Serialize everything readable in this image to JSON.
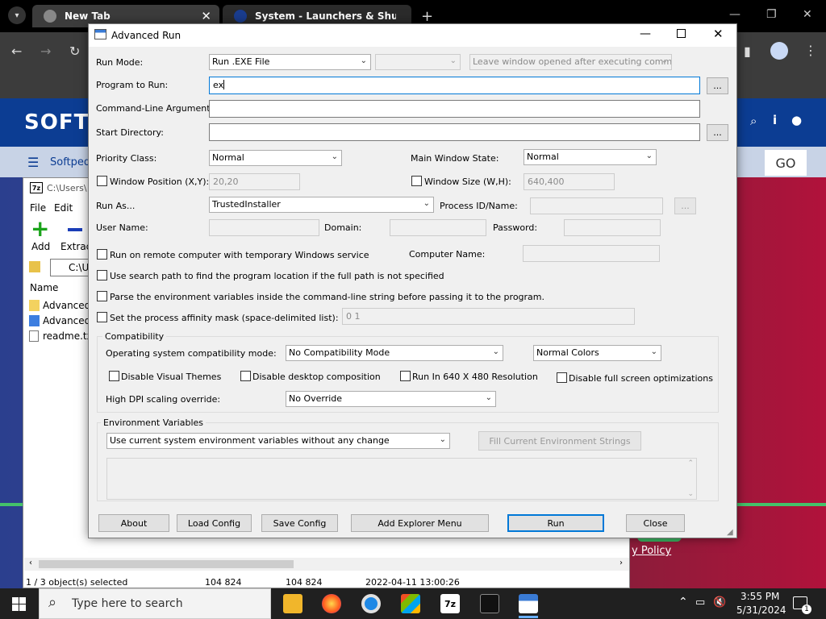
{
  "browser": {
    "tabs": [
      {
        "title": "New Tab"
      },
      {
        "title": "System - Launchers & Shutdow"
      }
    ]
  },
  "softpedia": {
    "logo": "SOFTI",
    "nav_label": "Softpedi",
    "go": "GO",
    "privacy_link": "y Policy"
  },
  "zip": {
    "path": "C:\\Users\\",
    "menu": [
      "File",
      "Edit"
    ],
    "tool_add": "Add",
    "tool_extract": "Extrac",
    "address": "C:\\U",
    "column_name": "Name",
    "files": [
      "Advanced",
      "Advanced",
      "readme.txt"
    ],
    "status": [
      "1 / 3 object(s) selected",
      "104 824",
      "104 824",
      "2022-04-11 13:00:26"
    ]
  },
  "dialog": {
    "title": "Advanced Run",
    "labels": {
      "run_mode": "Run Mode:",
      "program_to_run": "Program to Run:",
      "cmd_args": "Command-Line Arguments:",
      "start_dir": "Start Directory:",
      "priority_class": "Priority Class:",
      "main_window_state": "Main Window State:",
      "window_position": "Window Position (X,Y):",
      "window_size": "Window Size (W,H):",
      "run_as": "Run As...",
      "process_id": "Process ID/Name:",
      "user_name": "User Name:",
      "domain": "Domain:",
      "password": "Password:",
      "remote": "Run on remote computer with temporary Windows service",
      "computer_name": "Computer Name:",
      "search_path": "Use search path to find the program location if the full path is not specified",
      "parse_env": "Parse the environment variables inside the command-line string before passing it to the program.",
      "affinity": "Set the process affinity mask (space-delimited list):",
      "compat_group": "Compatibility",
      "os_compat": "Operating system compatibility mode:",
      "disable_themes": "Disable Visual Themes",
      "disable_desktop": "Disable desktop composition",
      "run_640": "Run In 640 X 480 Resolution",
      "disable_fullscreen": "Disable full screen optimizations",
      "dpi_override": "High DPI scaling override:",
      "env_group": "Environment Variables"
    },
    "values": {
      "run_mode": "Run .EXE File",
      "leave_window": "Leave window opened after executing command",
      "program": "ex",
      "priority": "Normal",
      "window_state": "Normal",
      "position": "20,20",
      "size": "640,400",
      "run_as": "TrustedInstaller",
      "affinity": "0 1",
      "compat_mode": "No Compatibility Mode",
      "colors": "Normal Colors",
      "dpi": "No Override",
      "env_mode": "Use current system environment variables without any change"
    },
    "buttons": {
      "browse": "...",
      "fill_env": "Fill Current Environment Strings",
      "about": "About",
      "load_config": "Load Config",
      "save_config": "Save Config",
      "add_explorer": "Add Explorer Menu",
      "run": "Run",
      "close": "Close"
    }
  },
  "taskbar": {
    "search_placeholder": "Type here to search",
    "time": "3:55 PM",
    "date": "5/31/2024",
    "notification_count": "1"
  }
}
